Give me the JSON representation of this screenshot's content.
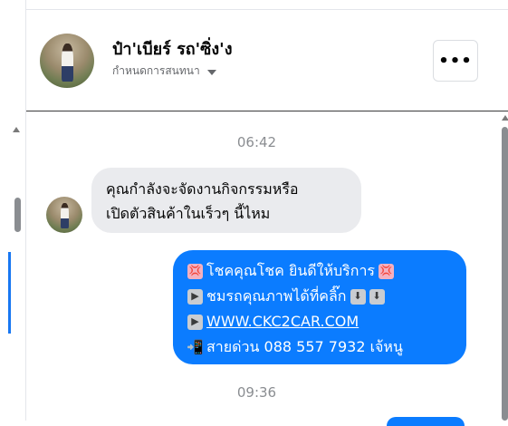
{
  "header": {
    "name": "ป๋า'เบียร์ รถ'ซิ่ง'ง",
    "subtitle": "กำหนดการสนทนา",
    "more_label": "•••"
  },
  "messages": {
    "timestamp_1": "06:42",
    "incoming": {
      "line_1": "คุณกำลังจะจัดงานกิจกรรมหรือ",
      "line_2": "เปิดตัวสินค้าในเร็วๆ นี้ไหม"
    },
    "outgoing": {
      "line_1": "โชคคุณโชค ยินดีให้บริการ",
      "line_2": "ชมรถคุณภาพได้ที่คลิ๊ก",
      "link": "WWW.CKC2CAR.COM",
      "line_4": "สายด่วน 088 557 7932 เจ้หนู"
    },
    "timestamp_2": "09:36"
  },
  "icons": {
    "sparkle_red": "💢",
    "play": "▶",
    "arrow_down": "⬇",
    "phone": "📲"
  },
  "colors": {
    "outgoing_bubble": "#0b7cff",
    "incoming_bubble": "#eaebee"
  }
}
